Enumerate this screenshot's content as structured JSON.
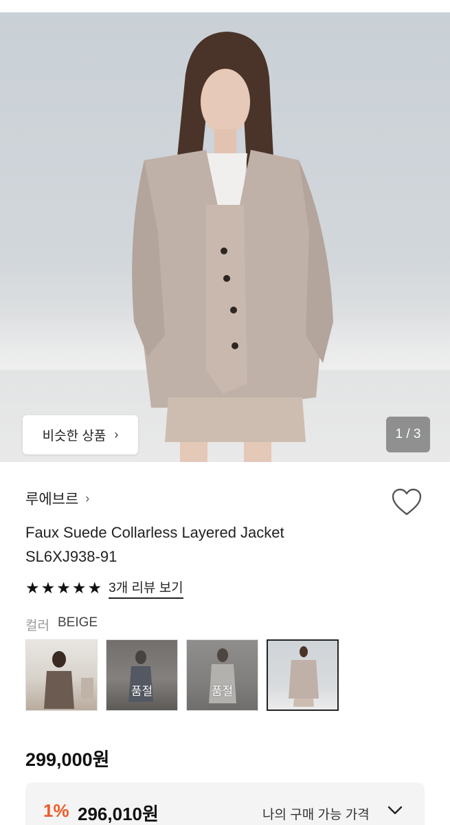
{
  "gallery": {
    "similar_button_label": "비슷한 상품",
    "counter": "1 / 3"
  },
  "product": {
    "brand": "루에브르",
    "name_line1": "Faux Suede Collarless Layered Jacket",
    "name_line2": "SL6XJ938-91",
    "rating_stars": 5,
    "review_link": "3개 리뷰 보기",
    "color_label": "컬러",
    "color_value": "BEIGE",
    "swatches": [
      {
        "status": "",
        "selected": false
      },
      {
        "status": "품절",
        "selected": false
      },
      {
        "status": "품절",
        "selected": false
      },
      {
        "status": "",
        "selected": true
      }
    ],
    "price": "299,000원"
  },
  "my_price": {
    "discount": "1%",
    "amount": "296,010원",
    "label": "나의 구매 가능 가격"
  },
  "icons": {
    "heart": "heart-outline-icon",
    "star": "star-filled-icon",
    "chevron_right": "chevron-right-icon",
    "chevron_down": "chevron-down-icon"
  },
  "colors": {
    "discount": "#f05a28",
    "text": "#222222"
  }
}
